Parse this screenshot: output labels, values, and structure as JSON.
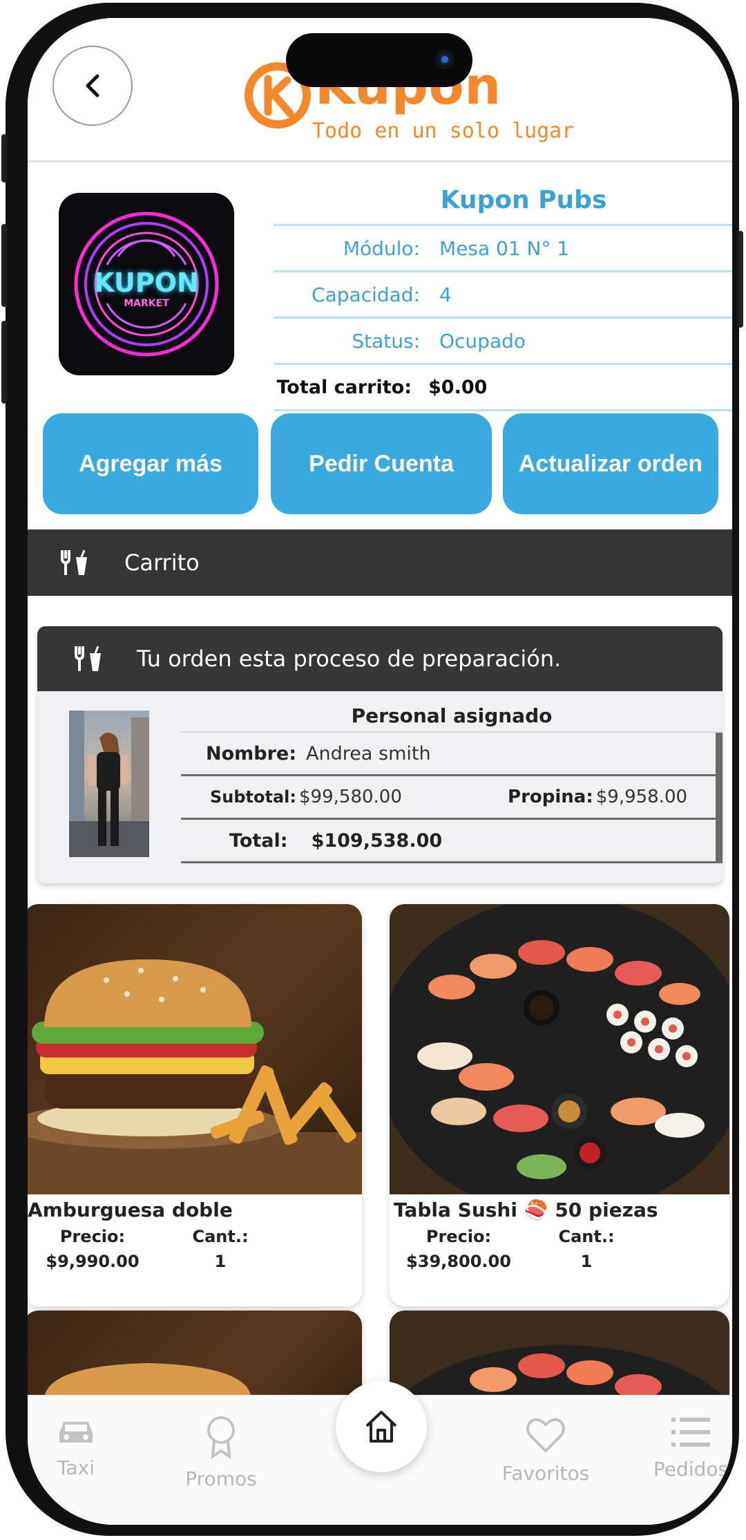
{
  "header": {
    "logo_text": "Kupon",
    "logo_tagline": "Todo en un solo lugar"
  },
  "store": {
    "name": "Kupon Pubs",
    "logo_text": "KUPON",
    "logo_subtext": "MARKET",
    "fields": [
      {
        "label": "Módulo:",
        "value": "Mesa 01 N° 1"
      },
      {
        "label": "Capacidad:",
        "value": "4"
      },
      {
        "label": "Status:",
        "value": "Ocupado"
      }
    ],
    "total_label": "Total carrito:",
    "total_value": "$0.00"
  },
  "actions": {
    "add_more": "Agregar más",
    "request_bill": "Pedir Cuenta",
    "update_order": "Actualizar orden"
  },
  "cart_section": {
    "title": "Carrito"
  },
  "order": {
    "status_message": "Tu orden esta proceso de preparación.",
    "staff_title": "Personal asignado",
    "name_label": "Nombre:",
    "name_value": "Andrea smith",
    "subtotal_label": "Subtotal:",
    "subtotal_value": "$99,580.00",
    "tip_label": "Propina:",
    "tip_value": "$9,958.00",
    "total_label": "Total:",
    "total_value": "$109,538.00"
  },
  "products": [
    {
      "name": "Amburguesa doble",
      "price_label": "Precio:",
      "price": "$9,990.00",
      "qty_label": "Cant.:",
      "qty": "1"
    },
    {
      "name": "Tabla Sushi 🍣 50 piezas",
      "price_label": "Precio:",
      "price": "$39,800.00",
      "qty_label": "Cant.:",
      "qty": "1"
    }
  ],
  "nav": {
    "taxi": "Taxi",
    "promos": "Promos",
    "favorites": "Favoritos",
    "orders": "Pedidos"
  },
  "colors": {
    "brand_orange": "#f5882b",
    "accent_blue": "#3aa9df",
    "dark_bar": "#353535"
  },
  "icons": [
    "back-chevron-icon",
    "utensils-icon",
    "car-icon",
    "medal-icon",
    "home-icon",
    "heart-icon",
    "list-icon"
  ]
}
